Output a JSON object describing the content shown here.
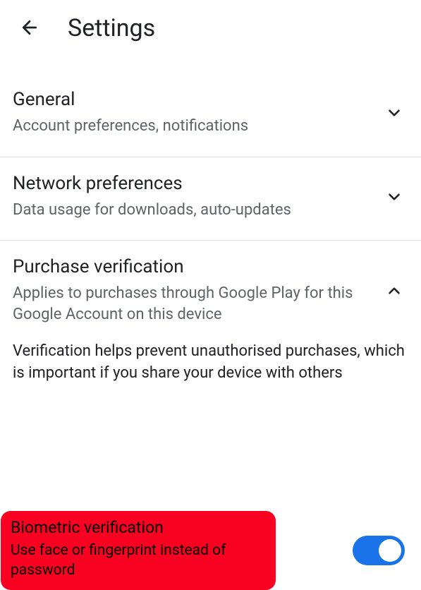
{
  "header": {
    "title": "Settings"
  },
  "sections": {
    "general": {
      "title": "General",
      "subtitle": "Account preferences, notifications"
    },
    "network": {
      "title": "Network preferences",
      "subtitle": "Data usage for downloads, auto-updates"
    },
    "purchase": {
      "title": "Purchase verification",
      "subtitle": "Applies to purchases through Google Play for this Google Account on this device",
      "info": "Verification helps prevent unauthorised purchases, which is important if you share your device with others"
    },
    "biometric": {
      "title": "Biometric verification",
      "subtitle": "Use face or fingerprint instead of password",
      "enabled": true
    }
  }
}
